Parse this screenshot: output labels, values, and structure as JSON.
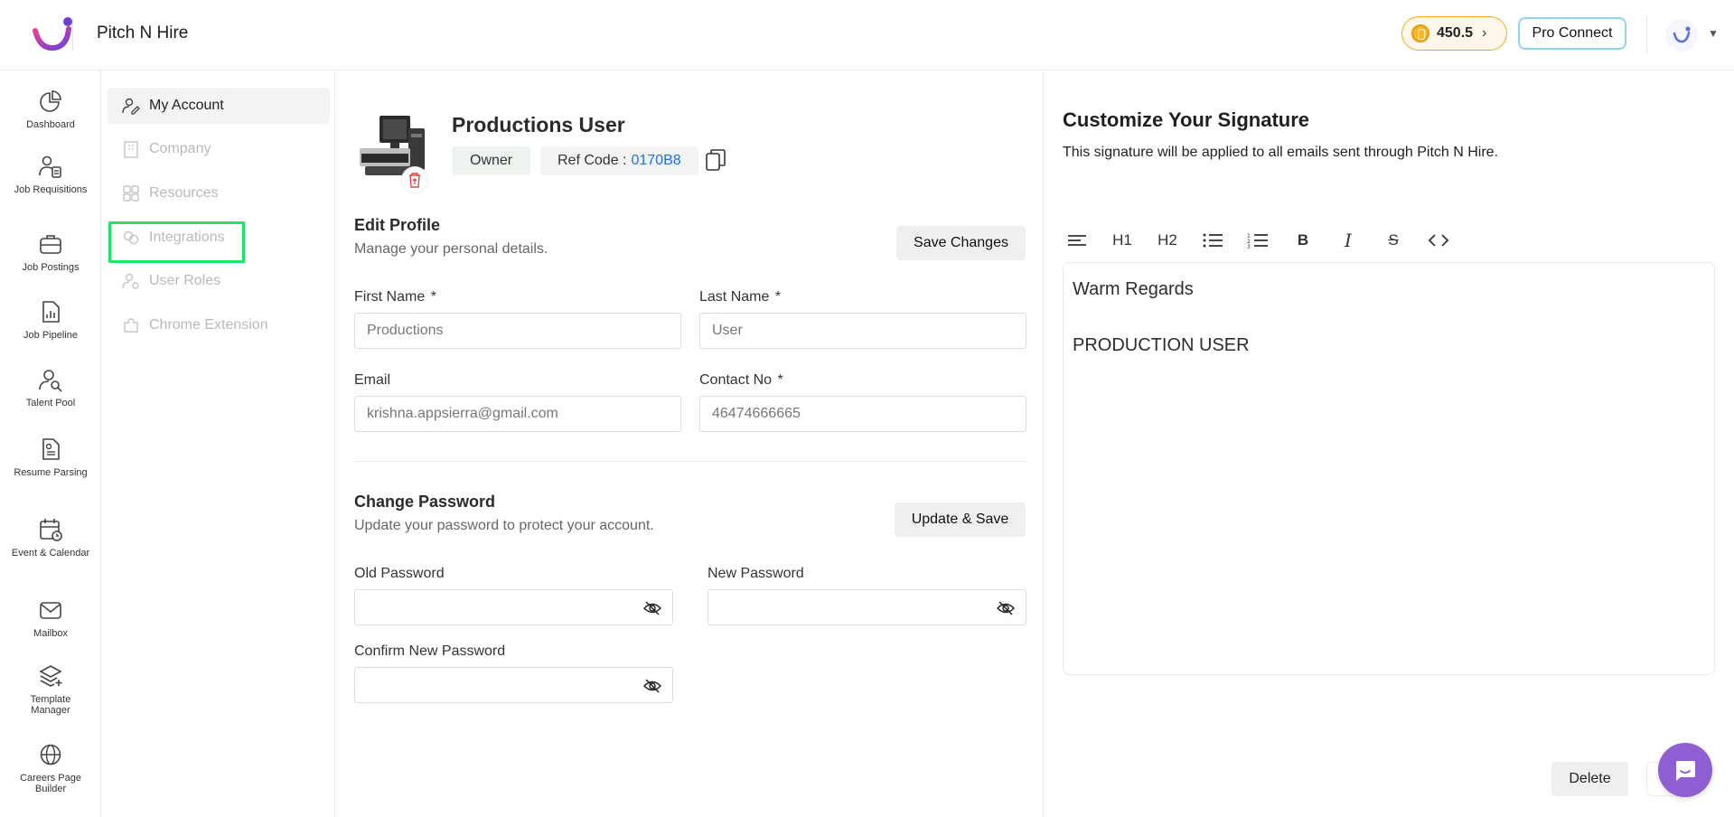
{
  "app": {
    "title": "Pitch N Hire",
    "credits": "450.5",
    "pro_connect_label": "Pro Connect"
  },
  "leftnav": [
    {
      "label": "Dashboard",
      "icon": "pie-chart-icon"
    },
    {
      "label": "Job Requisitions",
      "icon": "user-doc-icon"
    },
    {
      "label": "Job Postings",
      "icon": "briefcase-icon"
    },
    {
      "label": "Job Pipeline",
      "icon": "file-chart-icon"
    },
    {
      "label": "Talent Pool",
      "icon": "user-search-icon"
    },
    {
      "label": "Resume Parsing",
      "icon": "resume-icon"
    },
    {
      "label": "Event & Calendar",
      "icon": "calendar-icon"
    },
    {
      "label": "Mailbox",
      "icon": "mail-icon"
    },
    {
      "label": "Template Manager",
      "icon": "layers-icon"
    },
    {
      "label": "Careers Page Builder",
      "icon": "globe-icon"
    }
  ],
  "subnav": [
    {
      "label": "My Account",
      "icon": "user-edit-icon"
    },
    {
      "label": "Company",
      "icon": "building-icon"
    },
    {
      "label": "Resources",
      "icon": "grid-icon"
    },
    {
      "label": "Integrations",
      "icon": "link-icon"
    },
    {
      "label": "User Roles",
      "icon": "user-settings-icon"
    },
    {
      "label": "Chrome Extension",
      "icon": "puzzle-icon"
    }
  ],
  "profile": {
    "name": "Productions User",
    "role": "Owner",
    "ref_label": "Ref Code :",
    "ref_code": "0170B8",
    "edit_title": "Edit Profile",
    "edit_sub": "Manage your personal details.",
    "save_label": "Save Changes",
    "first_name_label": "First Name",
    "first_name_value": "Productions",
    "last_name_label": "Last Name",
    "last_name_value": "User",
    "email_label": "Email",
    "email_value": "krishna.appsierra@gmail.com",
    "contact_label": "Contact No",
    "contact_value": "46474666665",
    "required_mark": "*",
    "pw_title": "Change Password",
    "pw_sub": "Update your password to protect your account.",
    "update_label": "Update & Save",
    "old_pw_label": "Old Password",
    "new_pw_label": "New Password",
    "confirm_pw_label": "Confirm New Password"
  },
  "signature": {
    "title": "Customize Your Signature",
    "subtitle": "This signature will be applied to all emails sent through Pitch N Hire.",
    "toolbar": {
      "h1": "H1",
      "h2": "H2",
      "bold": "B",
      "italic": "I",
      "strike": "S"
    },
    "line1": "Warm Regards",
    "line2": "PRODUCTION USER",
    "delete_label": "Delete"
  },
  "colors": {
    "accent_green": "#22e36a",
    "link_blue": "#1b72e8",
    "chat_purple": "#8f5ed3",
    "coin_orange": "#f2a91d"
  }
}
